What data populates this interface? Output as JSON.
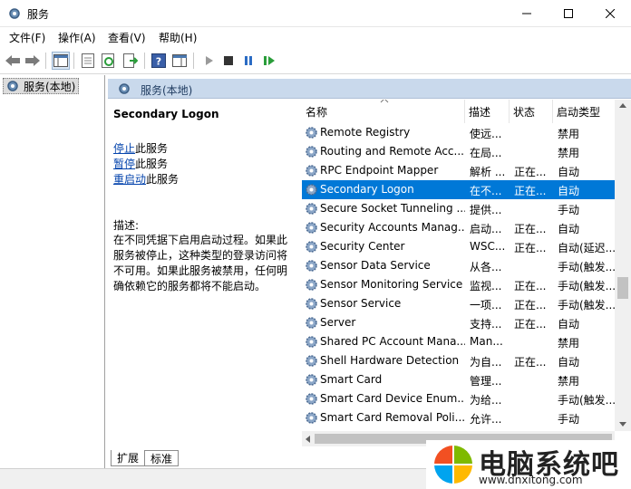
{
  "window": {
    "title": "服务"
  },
  "menu": [
    "文件(F)",
    "操作(A)",
    "查看(V)",
    "帮助(H)"
  ],
  "toolbar": {
    "icons": [
      "back-arrow-icon",
      "forward-arrow-icon",
      "console-tree-icon",
      "properties-icon",
      "refresh-icon",
      "export-icon",
      "help-icon",
      "view-icon",
      "start-service-icon",
      "stop-service-icon",
      "pause-service-icon",
      "restart-service-icon"
    ]
  },
  "tree": {
    "label": "服务(本地)"
  },
  "pane": {
    "header": "服务(本地)"
  },
  "detail": {
    "title": "Secondary Logon",
    "actions": [
      {
        "link": "停止",
        "suffix": "此服务"
      },
      {
        "link": "暂停",
        "suffix": "此服务"
      },
      {
        "link": "重启动",
        "suffix": "此服务"
      }
    ],
    "desc_label": "描述:",
    "desc_text": "在不同凭据下启用启动过程。如果此服务被停止，这种类型的登录访问将不可用。如果此服务被禁用，任何明确依赖它的服务都将不能启动。"
  },
  "columns": [
    "名称",
    "描述",
    "状态",
    "启动类型"
  ],
  "services": [
    {
      "name": "Remote Registry",
      "desc": "使远...",
      "status": "",
      "type": "禁用"
    },
    {
      "name": "Routing and Remote Acc...",
      "desc": "在局...",
      "status": "",
      "type": "禁用"
    },
    {
      "name": "RPC Endpoint Mapper",
      "desc": "解析 ...",
      "status": "正在...",
      "type": "自动"
    },
    {
      "name": "Secondary Logon",
      "desc": "在不...",
      "status": "正在...",
      "type": "自动",
      "selected": true
    },
    {
      "name": "Secure Socket Tunneling ...",
      "desc": "提供...",
      "status": "",
      "type": "手动"
    },
    {
      "name": "Security Accounts Manag...",
      "desc": "启动...",
      "status": "正在...",
      "type": "自动"
    },
    {
      "name": "Security Center",
      "desc": "WSC...",
      "status": "正在...",
      "type": "自动(延迟..."
    },
    {
      "name": "Sensor Data Service",
      "desc": "从各...",
      "status": "",
      "type": "手动(触发..."
    },
    {
      "name": "Sensor Monitoring Service",
      "desc": "监视...",
      "status": "正在...",
      "type": "手动(触发..."
    },
    {
      "name": "Sensor Service",
      "desc": "一项...",
      "status": "正在...",
      "type": "手动(触发..."
    },
    {
      "name": "Server",
      "desc": "支持...",
      "status": "正在...",
      "type": "自动"
    },
    {
      "name": "Shared PC Account Mana...",
      "desc": "Man...",
      "status": "",
      "type": "禁用"
    },
    {
      "name": "Shell Hardware Detection",
      "desc": "为自...",
      "status": "正在...",
      "type": "自动"
    },
    {
      "name": "Smart Card",
      "desc": "管理...",
      "status": "",
      "type": "禁用"
    },
    {
      "name": "Smart Card Device Enum...",
      "desc": "为给...",
      "status": "",
      "type": "手动(触发..."
    },
    {
      "name": "Smart Card Removal Poli...",
      "desc": "允许...",
      "status": "",
      "type": "手动"
    }
  ],
  "tabs": [
    "扩展",
    "标准"
  ],
  "watermark": {
    "title": "电脑系统吧",
    "url": "www.dnxitong.com"
  },
  "colors": {
    "selection": "#0078d7",
    "header_bg": "#c9d9ec",
    "link": "#0645ad"
  }
}
